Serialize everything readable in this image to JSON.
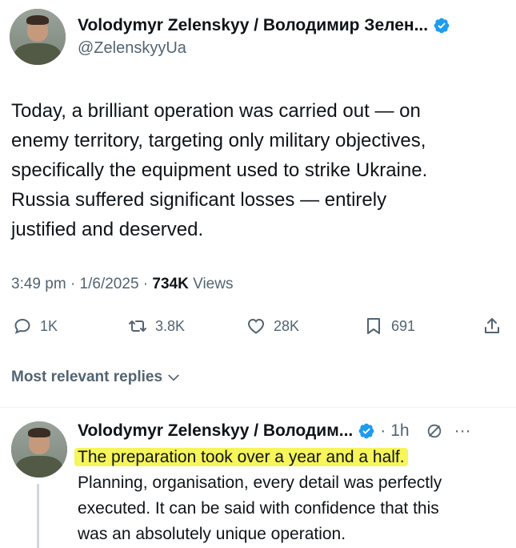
{
  "tweet": {
    "author_name": "Volodymyr Zelenskyy / Володимир Зелен...",
    "handle": "@ZelenskyyUa",
    "text_lines": [
      "Today, a brilliant operation was carried out — on",
      "enemy territory, targeting only military objectives,",
      "specifically the equipment used to strike Ukraine.",
      "Russia suffered significant losses — entirely",
      "justified and deserved."
    ],
    "time": "3:49 pm",
    "date": "1/6/2025",
    "views_count": "734K",
    "views_label": "Views",
    "replies": "1K",
    "reposts": "3.8K",
    "likes": "28K",
    "bookmarks": "691"
  },
  "replies_sort": {
    "label": "Most relevant replies"
  },
  "reply": {
    "author_name": "Volodymyr Zelenskyy / Володим...",
    "age": "1h",
    "more": "···",
    "highlighted_line": "The preparation took over a year and a half.",
    "text_lines": [
      "Planning, organisation, every detail was perfectly",
      "executed. It can be said with confidence that this",
      "was an absolutely unique operation."
    ]
  },
  "colors": {
    "verified": "#1d9bf0",
    "highlight": "#f6f55a",
    "muted": "#536471"
  },
  "icons": [
    "verified-badge-icon",
    "reply-icon",
    "repost-icon",
    "like-icon",
    "bookmark-icon",
    "share-icon",
    "chevron-down-icon",
    "grok-icon",
    "more-icon"
  ]
}
